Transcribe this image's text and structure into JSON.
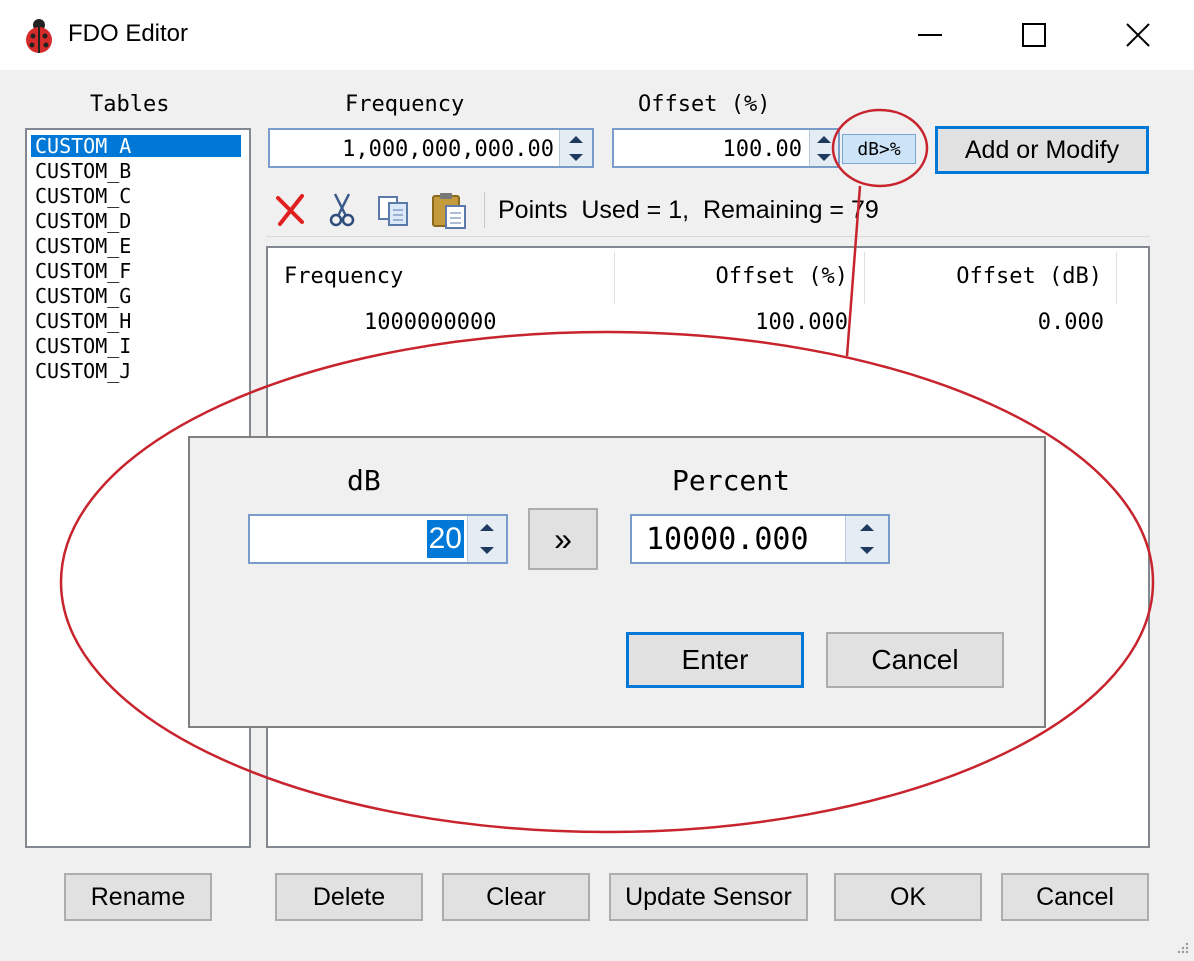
{
  "window": {
    "title": "FDO Editor"
  },
  "tables": {
    "label": "Tables",
    "items": [
      "CUSTOM_A",
      "CUSTOM_B",
      "CUSTOM_C",
      "CUSTOM_D",
      "CUSTOM_E",
      "CUSTOM_F",
      "CUSTOM_G",
      "CUSTOM_H",
      "CUSTOM_I",
      "CUSTOM_J"
    ],
    "selected": "CUSTOM_A"
  },
  "inputs": {
    "frequency_label": "Frequency",
    "frequency_value": "1,000,000,000.00",
    "offset_label": "Offset (%)",
    "offset_value": "100.00",
    "db_to_pct_label": "dB>%",
    "add_modify_label": "Add or Modify"
  },
  "toolbar": {
    "status": "Points  Used = 1,  Remaining = 79"
  },
  "grid": {
    "columns": [
      "Frequency",
      "Offset (%)",
      "Offset (dB)"
    ],
    "rows": [
      {
        "frequency": "1000000000",
        "offset_pct": "100.000",
        "offset_db": "0.000"
      }
    ]
  },
  "dialog": {
    "db_label": "dB",
    "db_value": "20",
    "convert_label": "»",
    "percent_label": "Percent",
    "percent_value": "10000.000",
    "enter_label": "Enter",
    "cancel_label": "Cancel"
  },
  "footer": {
    "rename": "Rename",
    "delete": "Delete",
    "clear": "Clear",
    "update_sensor": "Update Sensor",
    "ok": "OK",
    "cancel": "Cancel"
  },
  "colors": {
    "selection": "#0078d7",
    "annotation": "#c8242e",
    "accent": "#0078d7"
  }
}
